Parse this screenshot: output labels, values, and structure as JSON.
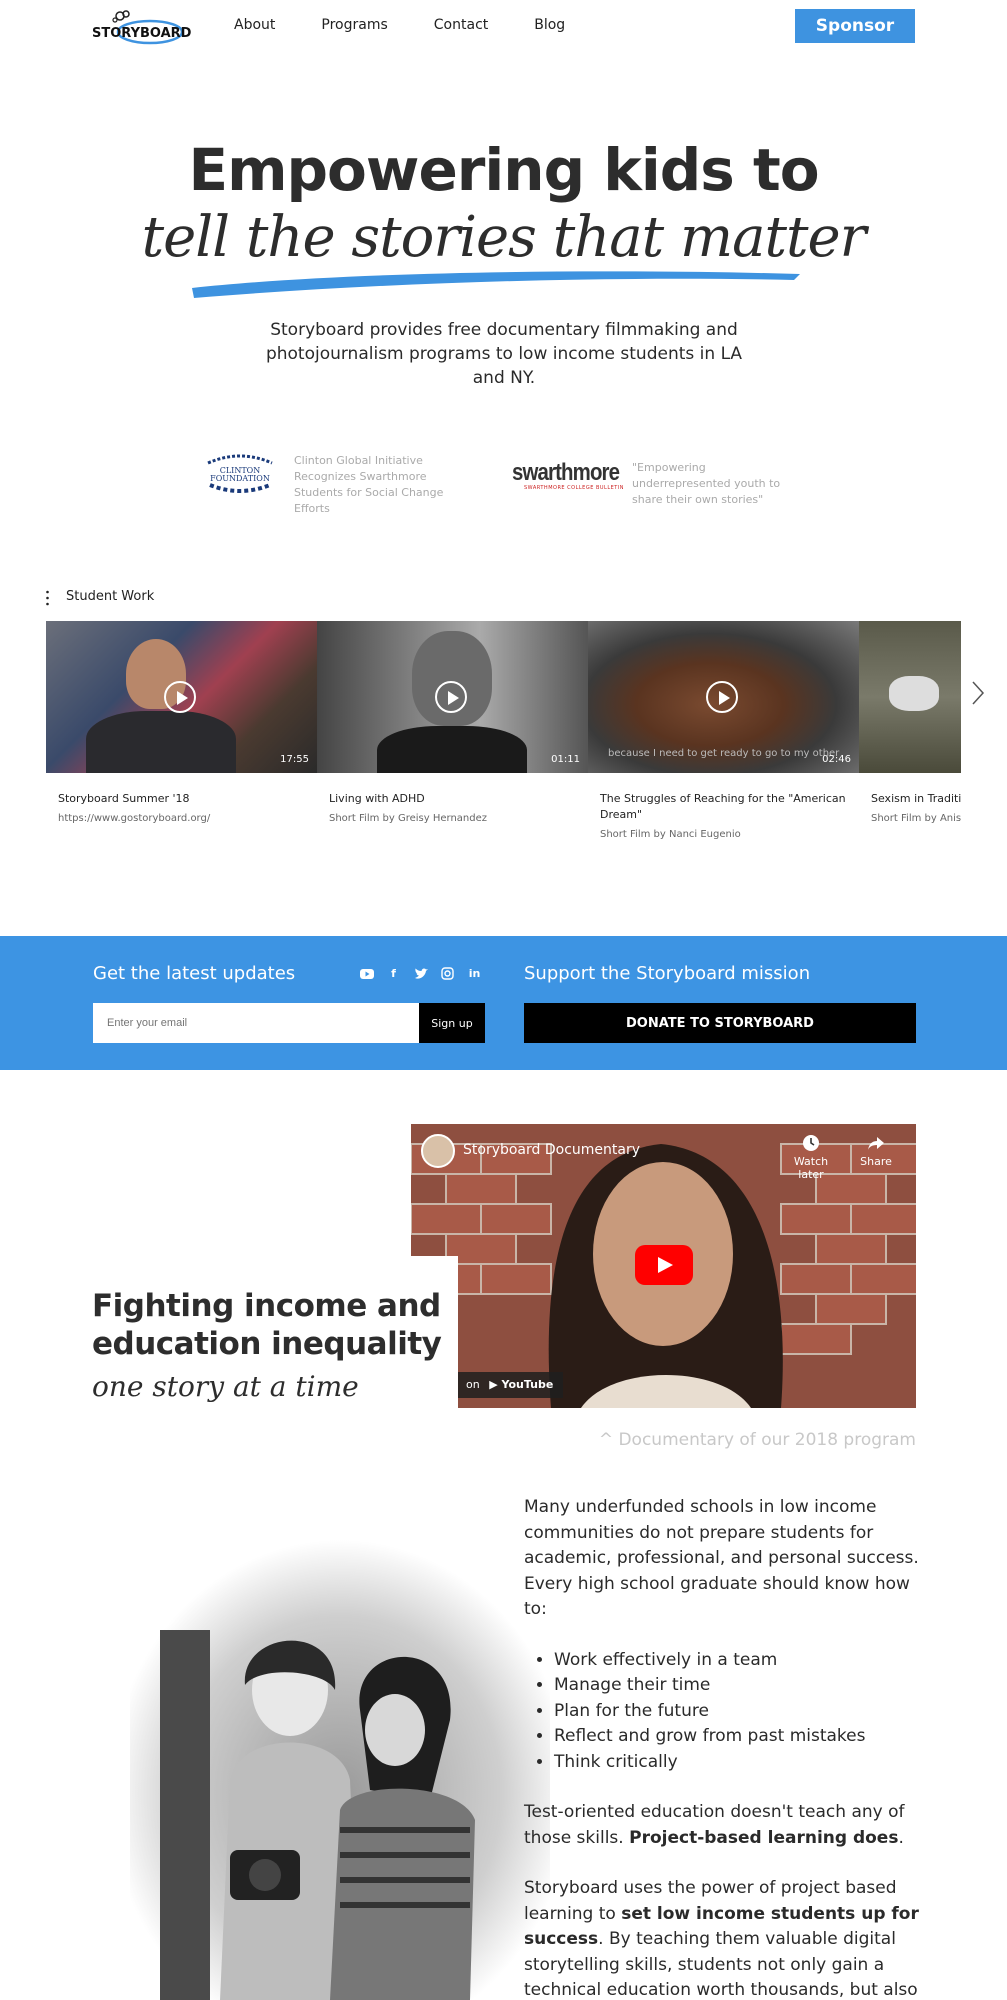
{
  "header": {
    "logo_text": "STORYBOARD",
    "nav": [
      "About",
      "Programs",
      "Contact",
      "Blog"
    ],
    "sponsor_label": "Sponsor"
  },
  "hero": {
    "line1": "Empowering kids to",
    "line2": "tell the stories that matter",
    "subtitle": "Storyboard provides free documentary filmmaking and photojournalism programs to low income students in LA and NY."
  },
  "press": [
    {
      "logo": "CLINTON FOUNDATION",
      "text": "Clinton Global Initiative Recognizes Swarthmore Students for Social Change Efforts"
    },
    {
      "logo": "swarthmore",
      "logo_sub": "SWARTHMORE COLLEGE BULLETIN",
      "text": "\"Empowering underrepresented youth to share their own stories\""
    }
  ],
  "student_work": {
    "title": "Student Work",
    "cards": [
      {
        "title": "Storyboard Summer '18",
        "subtitle": "https://www.gostoryboard.org/",
        "duration": "17:55",
        "caption": ""
      },
      {
        "title": "Living with ADHD",
        "subtitle": "Short Film by Greisy Hernandez",
        "duration": "01:11",
        "caption": ""
      },
      {
        "title": "The Struggles of Reaching for the \"American Dream\"",
        "subtitle": "Short Film by Nanci Eugenio",
        "duration": "02:46",
        "caption": "because I need to get ready to go to my other"
      },
      {
        "title": "Sexism in Traditio",
        "subtitle": "Short Film by Anissa",
        "duration": "",
        "caption": ""
      }
    ]
  },
  "updates": {
    "heading": "Get the latest updates",
    "email_placeholder": "Enter your email",
    "signup_label": "Sign up",
    "socials": [
      "youtube-icon",
      "facebook-icon",
      "twitter-icon",
      "instagram-icon",
      "linkedin-icon"
    ]
  },
  "support": {
    "heading": "Support the Storyboard mission",
    "donate_label": "DONATE TO STORYBOARD"
  },
  "documentary": {
    "video_title": "Storyboard Documentary",
    "watch_later": "Watch later",
    "share": "Share",
    "watch_on": "on",
    "youtube": "YouTube",
    "heading": "Fighting income and education inequality",
    "tagline": "one story at a time",
    "caption": "^ Documentary of our 2018 program"
  },
  "mission": {
    "intro": "Many underfunded schools in low income communities do not prepare students for academic, professional, and personal success. Every high school graduate should know how to:",
    "skills": [
      "Work effectively in a team",
      "Manage their time",
      "Plan for the future",
      "Reflect and grow from past mistakes",
      "Think critically"
    ],
    "p2_a": "Test-oriented education doesn't teach any of those skills. ",
    "p2_b": "Project-based learning does",
    "p2_c": ".",
    "p3_a": "Storyboard uses the power of project based learning to ",
    "p3_b": "set low income students up for success",
    "p3_c": ". By teaching them valuable digital storytelling skills, students not only gain a technical education worth thousands, but also"
  },
  "colors": {
    "accent": "#3e93e0",
    "band": "#3d94e3",
    "dark": "#2d2d2d"
  }
}
